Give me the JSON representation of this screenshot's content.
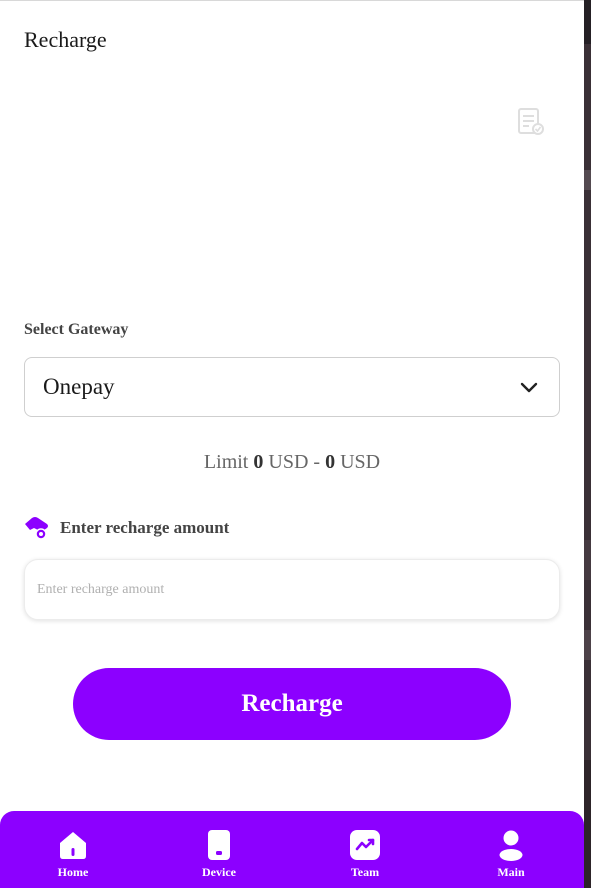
{
  "header": {
    "title": "Recharge",
    "records_icon": "records-list-icon"
  },
  "gateway": {
    "label": "Select Gateway",
    "selected": "Onepay"
  },
  "limit": {
    "prefix": "Limit",
    "min": "0",
    "min_unit": "USD",
    "separator": "-",
    "max": "0",
    "max_unit": "USD"
  },
  "amount": {
    "label": "Enter recharge amount",
    "placeholder": "Enter recharge amount",
    "value": "",
    "icon": "coin-hand-icon"
  },
  "recharge_button": {
    "label": "Recharge"
  },
  "nav": {
    "items": [
      {
        "label": "Home",
        "icon": "home-icon"
      },
      {
        "label": "Device",
        "icon": "device-icon"
      },
      {
        "label": "Team",
        "icon": "team-chart-icon"
      },
      {
        "label": "Main",
        "icon": "user-icon"
      }
    ]
  },
  "colors": {
    "accent": "#8c00ff",
    "background": "#ffffff",
    "text": "#1a1a1a",
    "muted_text": "#666666"
  }
}
